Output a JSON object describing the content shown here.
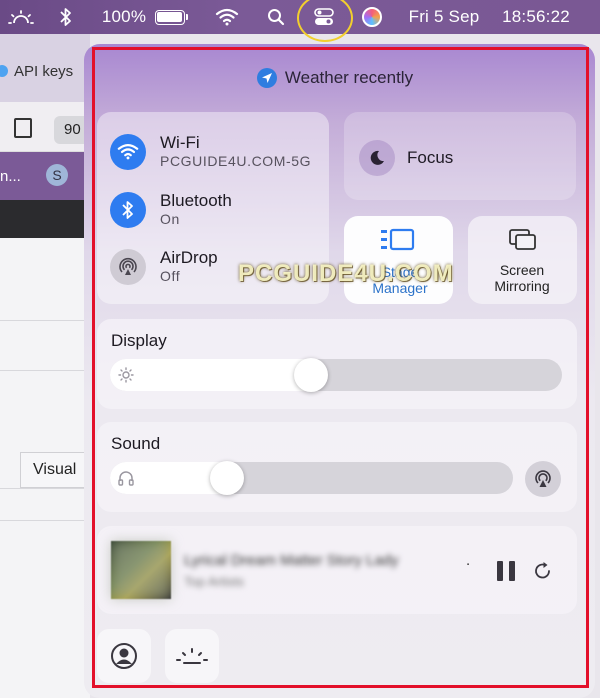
{
  "menubar": {
    "battery_percent": "100%",
    "date": "Fri 5 Sep",
    "time": "18:56:22",
    "icons": [
      "brightness-icon",
      "bluetooth-icon",
      "battery-icon",
      "wifi-icon",
      "search-icon",
      "control-center-icon",
      "siri-icon"
    ],
    "highlight_color": "#f2cf2d"
  },
  "background_app": {
    "tab_label": "API keys",
    "zoom_text": "90",
    "bookmark_left": "n...",
    "bookmark_s": "S",
    "visual_label": "Visual"
  },
  "control_center": {
    "header": "Weather recently",
    "wifi": {
      "title": "Wi-Fi",
      "subtitle": "PCGUIDE4U.COM-5G"
    },
    "bluetooth": {
      "title": "Bluetooth",
      "subtitle": "On"
    },
    "airdrop": {
      "title": "AirDrop",
      "subtitle": "Off"
    },
    "focus": {
      "label": "Focus"
    },
    "stage_manager": {
      "line1": "Stage",
      "line2": "Manager"
    },
    "screen_mirroring": {
      "line1": "Screen",
      "line2": "Mirroring"
    },
    "display": {
      "label": "Display",
      "level": 0.44
    },
    "sound": {
      "label": "Sound",
      "level": 0.27
    },
    "now_playing": {
      "title": "Lyrical Dream Matter Story Lady",
      "artist": "Top Artists",
      "trailing": "."
    },
    "accent_color": "#2e7cf0",
    "annotation_color": "#e3102a"
  },
  "watermark": "PCGUIDE4U.COM"
}
